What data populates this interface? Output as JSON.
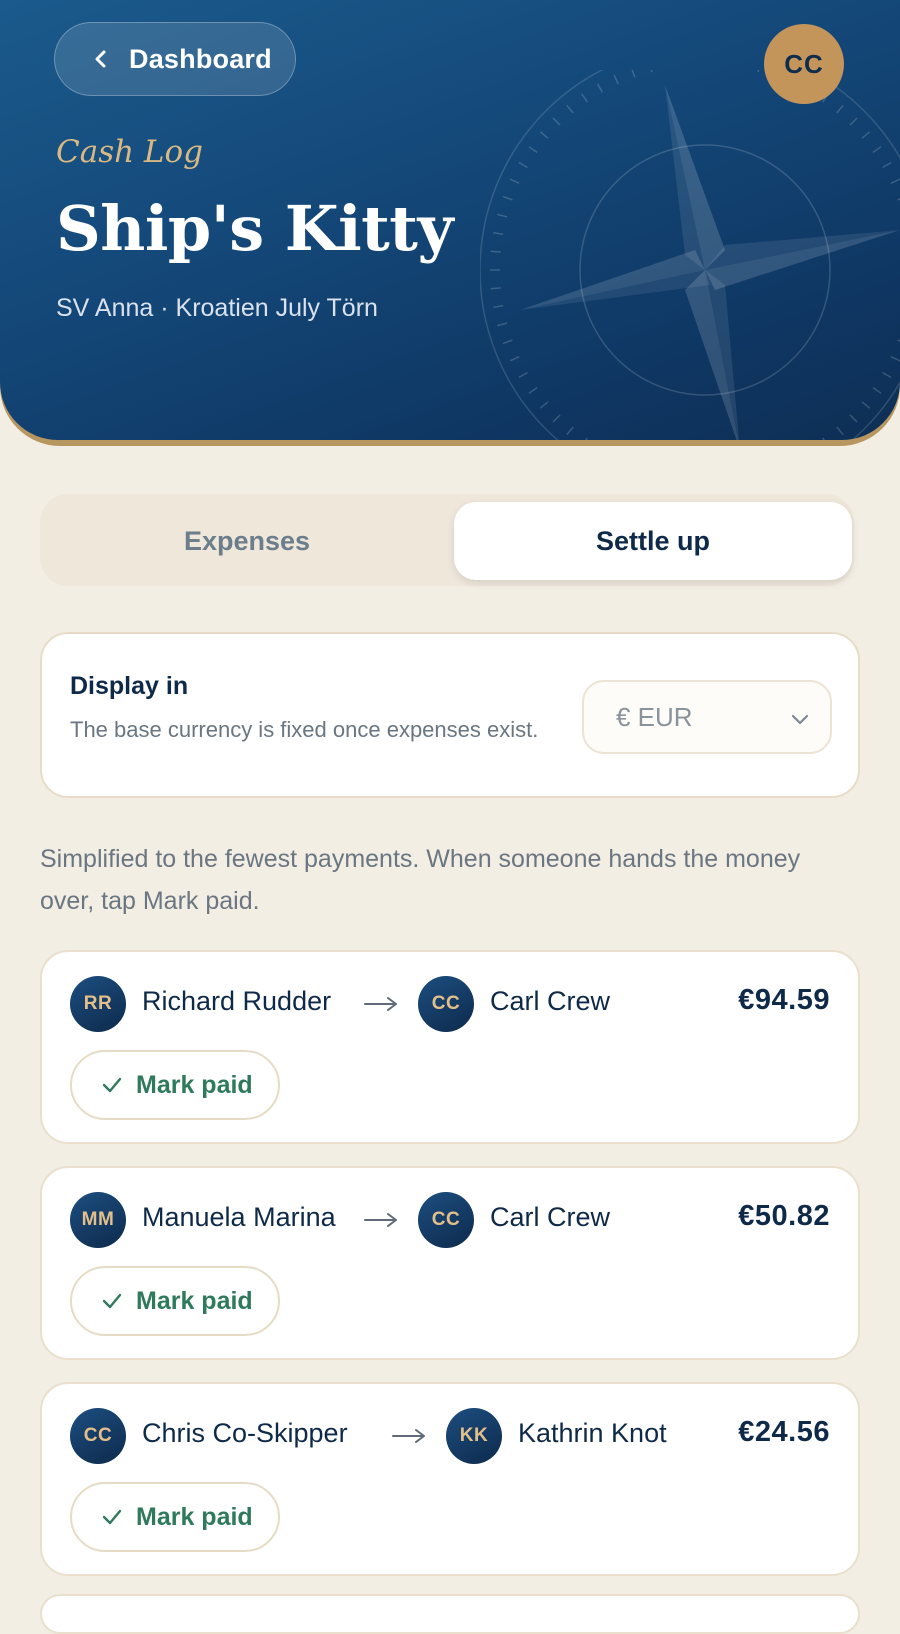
{
  "header": {
    "back_label": "Dashboard",
    "user_initials": "CC",
    "kicker": "Cash Log",
    "title": "Ship's Kitty",
    "subtitle": "SV Anna · Kroatien July Törn"
  },
  "tabs": [
    {
      "label": "Expenses",
      "active": false
    },
    {
      "label": "Settle up",
      "active": true
    }
  ],
  "display": {
    "label": "Display in",
    "help": "The base currency is fixed once expenses exist.",
    "currency": "€ EUR"
  },
  "intro": "Simplified to the fewest payments. When someone hands the money over, tap Mark paid.",
  "settlements": [
    {
      "from": {
        "initials": "RR",
        "name": "Richard Rudder"
      },
      "to": {
        "initials": "CC",
        "name": "Carl Crew"
      },
      "amount": "€94.59",
      "action": "Mark paid"
    },
    {
      "from": {
        "initials": "MM",
        "name": "Manuela Marina"
      },
      "to": {
        "initials": "CC",
        "name": "Carl Crew"
      },
      "amount": "€50.82",
      "action": "Mark paid"
    },
    {
      "from": {
        "initials": "CC",
        "name": "Chris Co-Skipper"
      },
      "to": {
        "initials": "KK",
        "name": "Kathrin Knot"
      },
      "amount": "€24.56",
      "action": "Mark paid"
    }
  ],
  "colors": {
    "header_blue": "#14497a",
    "gold_accent": "#c4955a",
    "background": "#f3eee4",
    "paid_green": "#2f7a5c"
  }
}
